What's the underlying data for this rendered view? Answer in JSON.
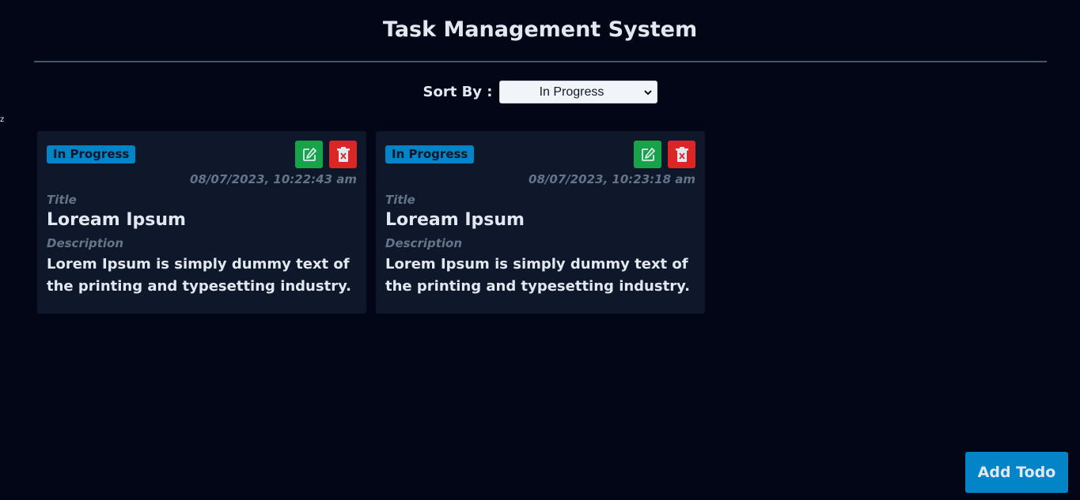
{
  "header": {
    "title": "Task Management System"
  },
  "sort": {
    "label": "Sort By :",
    "selected": "In Progress"
  },
  "stray_char": "z",
  "tasks": [
    {
      "status": "In Progress",
      "date": "08/07/2023, 10:22:43 am",
      "title_label": "Title",
      "title": "Loream Ipsum",
      "description_label": "Description",
      "description": "Lorem Ipsum is simply dummy text of the printing and typesetting industry."
    },
    {
      "status": "In Progress",
      "date": "08/07/2023, 10:23:18 am",
      "title_label": "Title",
      "title": "Loream Ipsum",
      "description_label": "Description",
      "description": "Lorem Ipsum is simply dummy text of the printing and typesetting industry."
    }
  ],
  "icons": {
    "edit": "edit-icon",
    "delete": "trash-icon"
  },
  "colors": {
    "background": "#020617",
    "card": "#0f172a",
    "accent": "#0284c7",
    "edit": "#16a34a",
    "delete": "#dc2626"
  },
  "footer": {
    "add_label": "Add Todo"
  }
}
